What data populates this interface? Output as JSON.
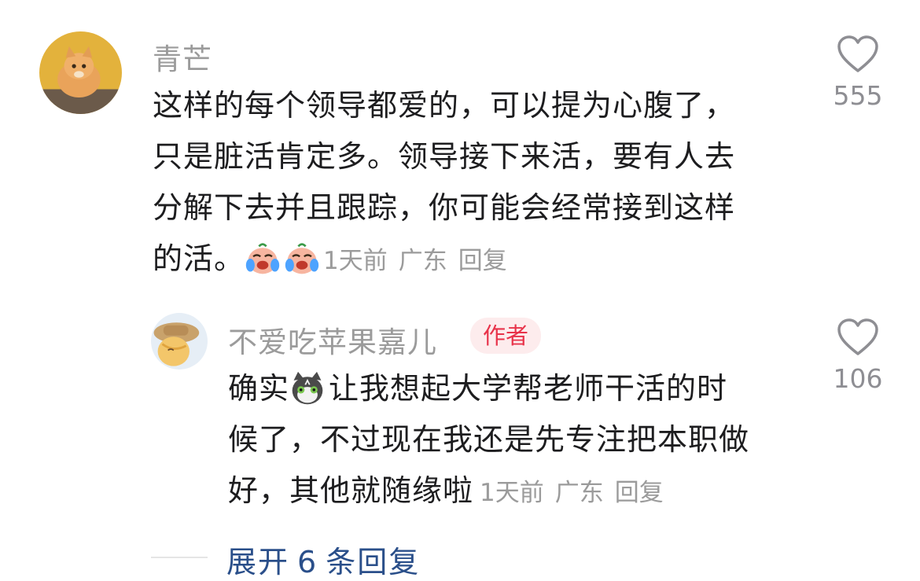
{
  "comments": [
    {
      "username": "青芒",
      "lines": [
        "这样的每个领导都爱的，可以提为心腹了，",
        "只是脏活肯定多。领导接下来活，要有人去",
        "分解下去并且跟踪，你可能会经常接到这样",
        "的活。"
      ],
      "emoji": [
        "crying-laughing-peach-emoji",
        "crying-laughing-peach-emoji"
      ],
      "time": "1天前",
      "location": "广东",
      "reply_label": "回复",
      "likes": "555",
      "avatar": "orange-cat-avatar"
    },
    {
      "username": "不爱吃苹果嘉儿",
      "badge": "作者",
      "lines": [
        "确实",
        "让我想起大学帮老师干活的时",
        "候了，不过现在我还是先专注把本职做",
        "好，其他就随缘啦"
      ],
      "emoji": [
        "cat-emoji"
      ],
      "time": "1天前",
      "location": "广东",
      "reply_label": "回复",
      "likes": "106",
      "avatar": "pony-avatar"
    }
  ],
  "expand": {
    "prefix": "展开",
    "count": "6",
    "suffix": "条回复"
  },
  "colors": {
    "meta": "#9b9b9b",
    "link": "#2a4f8a",
    "badge_bg": "#fdeced",
    "badge_text": "#e8334a"
  }
}
